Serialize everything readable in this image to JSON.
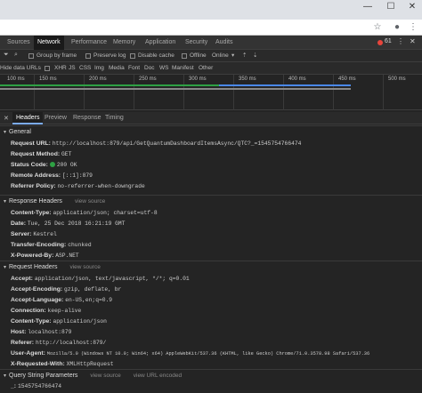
{
  "window": {
    "minimize": "—",
    "maximize": "☐",
    "close": "✕"
  },
  "addressbar": {
    "star": "☆",
    "account": "●",
    "menu": "⋮"
  },
  "devtools_tabs": [
    "Sources",
    "Network",
    "Performance",
    "Memory",
    "Application",
    "Security",
    "Audits"
  ],
  "error_count": "61",
  "toolbar1": {
    "group_by_frame": "Group by frame",
    "preserve_log": "Preserve log",
    "disable_cache": "Disable cache",
    "offline": "Offline",
    "throttle": "Online"
  },
  "toolbar2": {
    "hide_data_urls": "Hide data URLs",
    "filters": [
      "XHR",
      "JS",
      "CSS",
      "Img",
      "Media",
      "Font",
      "Doc",
      "WS",
      "Manifest",
      "Other"
    ]
  },
  "timeline": {
    "ticks": [
      "50 ms",
      "100 ms",
      "150 ms",
      "200 ms",
      "250 ms",
      "300 ms",
      "350 ms",
      "400 ms",
      "450 ms",
      "500 ms"
    ]
  },
  "detail_tabs": [
    "Headers",
    "Preview",
    "Response",
    "Timing"
  ],
  "general": {
    "title": "General",
    "rows": [
      {
        "k": "Request URL:",
        "v": "http://localhost:879/api/GetQuantumDashboardItemsAsync/QTC?_=1545754766474"
      },
      {
        "k": "Request Method:",
        "v": "GET"
      },
      {
        "k": "Status Code:",
        "v": "200 OK"
      },
      {
        "k": "Remote Address:",
        "v": "[::1]:879"
      },
      {
        "k": "Referrer Policy:",
        "v": "no-referrer-when-downgrade"
      }
    ]
  },
  "response_headers": {
    "title": "Response Headers",
    "link": "view source",
    "rows": [
      {
        "k": "Content-Type:",
        "v": "application/json; charset=utf-8"
      },
      {
        "k": "Date:",
        "v": "Tue, 25 Dec 2018 16:21:19 GMT"
      },
      {
        "k": "Server:",
        "v": "Kestrel"
      },
      {
        "k": "Transfer-Encoding:",
        "v": "chunked"
      },
      {
        "k": "X-Powered-By:",
        "v": "ASP.NET"
      }
    ]
  },
  "request_headers": {
    "title": "Request Headers",
    "link": "view source",
    "rows": [
      {
        "k": "Accept:",
        "v": "application/json, text/javascript, */*; q=0.01"
      },
      {
        "k": "Accept-Encoding:",
        "v": "gzip, deflate, br"
      },
      {
        "k": "Accept-Language:",
        "v": "en-US,en;q=0.9"
      },
      {
        "k": "Connection:",
        "v": "keep-alive"
      },
      {
        "k": "Content-Type:",
        "v": "application/json"
      },
      {
        "k": "Host:",
        "v": "localhost:879"
      },
      {
        "k": "Referer:",
        "v": "http://localhost:879/"
      },
      {
        "k": "User-Agent:",
        "v": "Mozilla/5.0 (Windows NT 10.0; Win64; x64) AppleWebKit/537.36 (KHTML, like Gecko) Chrome/71.0.3578.98 Safari/537.36"
      },
      {
        "k": "X-Requested-With:",
        "v": "XMLHttpRequest"
      }
    ]
  },
  "query_params": {
    "title": "Query String Parameters",
    "link": "view source",
    "link2": "view URL encoded",
    "rows": [
      {
        "k": "_:",
        "v": "1545754766474"
      }
    ]
  }
}
